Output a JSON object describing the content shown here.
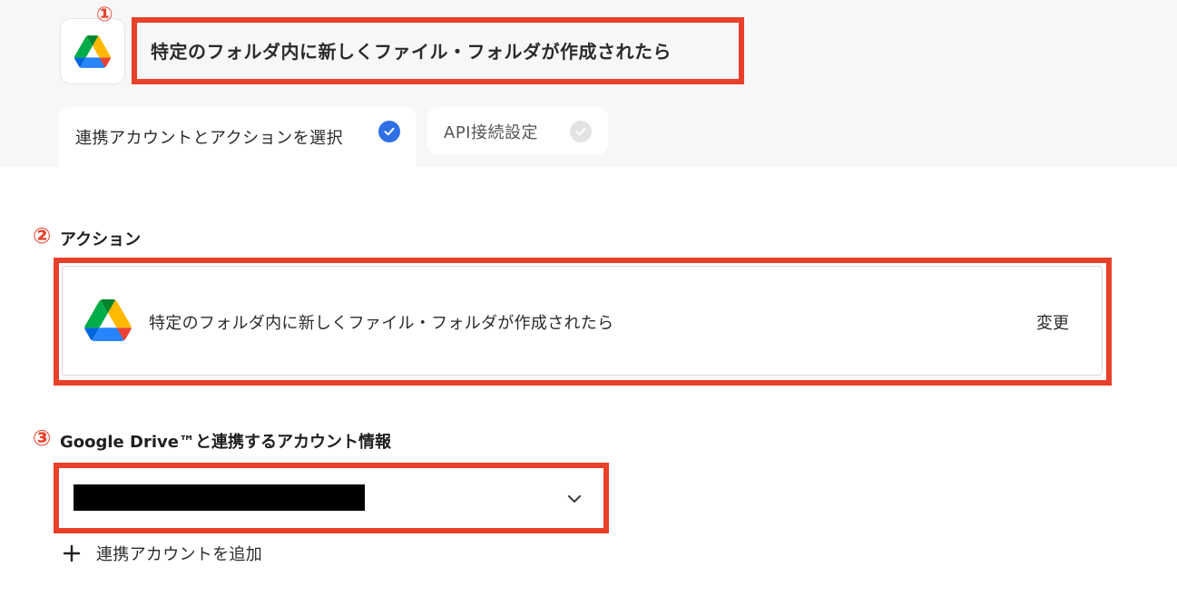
{
  "header": {
    "title": "特定のフォルダ内に新しくファイル・フォルダが作成されたら",
    "app_icon": "google-drive-icon",
    "annotation": "①"
  },
  "tabs": [
    {
      "label": "連携アカウントとアクションを選択",
      "completed": true,
      "active": true
    },
    {
      "label": "API接続設定",
      "completed": false,
      "active": false
    }
  ],
  "action_section": {
    "annotation": "②",
    "label": "アクション",
    "action_name": "特定のフォルダ内に新しくファイル・フォルダが作成されたら",
    "change_label": "変更"
  },
  "account_section": {
    "annotation": "③",
    "label": "Google Drive™と連携するアカウント情報",
    "selected_value": "",
    "add_account_label": "連携アカウントを追加"
  },
  "colors": {
    "annotation_red": "#e8402a",
    "check_blue": "#2f6fe6",
    "header_bg": "#f7f7f7"
  }
}
